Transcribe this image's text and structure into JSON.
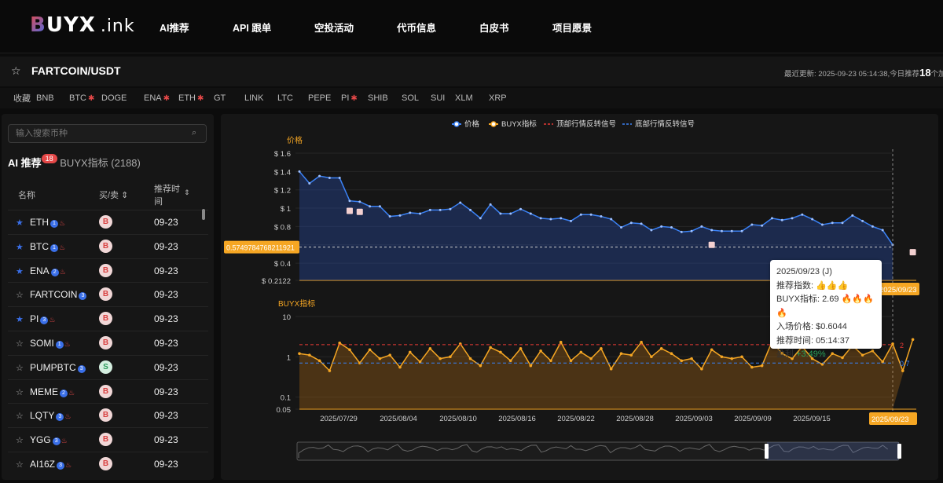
{
  "logo": {
    "text_b": "B",
    "text_rest": "UYX",
    "ink": ".ink"
  },
  "nav": [
    "AI推荐",
    "API 跟单",
    "空投活动",
    "代币信息",
    "白皮书",
    "项目愿景"
  ],
  "pair": {
    "name": "FARTCOIN/USDT",
    "updated": "最近更新: 2025-09-23 05:14:38,今日推荐",
    "count": "18",
    "trail": "个加"
  },
  "fav": {
    "label": "收藏",
    "items": [
      {
        "t": "BNB",
        "d": false
      },
      {
        "t": "BTC",
        "d": true
      },
      {
        "t": "DOGE",
        "d": false
      },
      {
        "t": "ENA",
        "d": true
      },
      {
        "t": "ETH",
        "d": true
      },
      {
        "t": "GT",
        "d": false
      },
      {
        "t": "LINK",
        "d": false
      },
      {
        "t": "LTC",
        "d": false
      },
      {
        "t": "PEPE",
        "d": false
      },
      {
        "t": "PI",
        "d": true
      },
      {
        "t": "SHIB",
        "d": false
      },
      {
        "t": "SOL",
        "d": false
      },
      {
        "t": "SUI",
        "d": false
      },
      {
        "t": "XLM",
        "d": false
      },
      {
        "t": "XRP",
        "d": false
      }
    ]
  },
  "search": {
    "placeholder": "输入搜索币种"
  },
  "tabs": {
    "ai": "AI 推荐",
    "ai_count": "18",
    "buyx": "BUYX指标 (2188)"
  },
  "table": {
    "h_name": "名称",
    "h_side": "买/卖 ⇕",
    "h_time1": "推荐时",
    "h_time2": "间",
    "rows": [
      {
        "name": "ETH",
        "star": true,
        "n": "1",
        "fire": true,
        "side": "B",
        "date": "09-23"
      },
      {
        "name": "BTC",
        "star": true,
        "n": "1",
        "fire": true,
        "side": "B",
        "date": "09-23"
      },
      {
        "name": "ENA",
        "star": true,
        "n": "2",
        "fire": true,
        "side": "B",
        "date": "09-23"
      },
      {
        "name": "FARTCOIN",
        "star": false,
        "n": "3",
        "fire": false,
        "side": "B",
        "date": "09-23"
      },
      {
        "name": "PI",
        "star": true,
        "n": "3",
        "fire": true,
        "side": "B",
        "date": "09-23"
      },
      {
        "name": "SOMI",
        "star": false,
        "n": "1",
        "fire": true,
        "side": "B",
        "date": "09-23"
      },
      {
        "name": "PUMPBTC",
        "star": false,
        "n": "3",
        "fire": false,
        "side": "S",
        "date": "09-23"
      },
      {
        "name": "MEME",
        "star": false,
        "n": "2",
        "fire": true,
        "side": "B",
        "date": "09-23"
      },
      {
        "name": "LQTY",
        "star": false,
        "n": "3",
        "fire": true,
        "side": "B",
        "date": "09-23"
      },
      {
        "name": "YGG",
        "star": false,
        "n": "3",
        "fire": true,
        "side": "B",
        "date": "09-23"
      },
      {
        "name": "AI16Z",
        "star": false,
        "n": "3",
        "fire": true,
        "side": "B",
        "date": "09-23"
      }
    ]
  },
  "legend": [
    "价格",
    "BUYX指标",
    "顶部行情反转信号",
    "底部行情反转信号"
  ],
  "colors": {
    "price": "#3b82f6",
    "buyx": "#f5a623",
    "top": "#e53935",
    "bottom": "#3b82f6"
  },
  "chart_data": [
    {
      "type": "line",
      "title": "价格",
      "ylabel": "价格",
      "y_ticks": [
        "$ 1.6",
        "$ 1.4",
        "$ 1.2",
        "$ 1",
        "$ 0.8",
        "$ 0.6",
        "$ 0.4",
        "$ 0.2122"
      ],
      "ylim": [
        0.2122,
        1.6
      ],
      "current_label": "0.5749784768211921",
      "x": [
        "2025/07/24",
        "2025/07/25",
        "2025/07/26",
        "2025/07/27",
        "2025/07/28",
        "2025/07/29",
        "2025/07/30",
        "2025/07/31",
        "2025/08/01",
        "2025/08/02",
        "2025/08/03",
        "2025/08/04",
        "2025/08/05",
        "2025/08/06",
        "2025/08/07",
        "2025/08/08",
        "2025/08/09",
        "2025/08/10",
        "2025/08/11",
        "2025/08/12",
        "2025/08/13",
        "2025/08/14",
        "2025/08/15",
        "2025/08/16",
        "2025/08/17",
        "2025/08/18",
        "2025/08/19",
        "2025/08/20",
        "2025/08/21",
        "2025/08/22",
        "2025/08/23",
        "2025/08/24",
        "2025/08/25",
        "2025/08/26",
        "2025/08/27",
        "2025/08/28",
        "2025/08/29",
        "2025/08/30",
        "2025/08/31",
        "2025/09/01",
        "2025/09/02",
        "2025/09/03",
        "2025/09/04",
        "2025/09/05",
        "2025/09/06",
        "2025/09/07",
        "2025/09/08",
        "2025/09/09",
        "2025/09/10",
        "2025/09/11",
        "2025/09/12",
        "2025/09/13",
        "2025/09/14",
        "2025/09/15",
        "2025/09/16",
        "2025/09/17",
        "2025/09/18",
        "2025/09/19",
        "2025/09/20",
        "2025/09/21",
        "2025/09/22",
        "2025/09/23"
      ],
      "series": [
        {
          "name": "价格",
          "values": [
            1.4,
            1.27,
            1.35,
            1.33,
            1.33,
            1.08,
            1.07,
            1.02,
            1.02,
            0.91,
            0.92,
            0.95,
            0.94,
            0.98,
            0.98,
            0.99,
            1.06,
            0.98,
            0.89,
            1.04,
            0.94,
            0.94,
            0.99,
            0.94,
            0.89,
            0.88,
            0.89,
            0.86,
            0.93,
            0.93,
            0.91,
            0.88,
            0.79,
            0.84,
            0.83,
            0.76,
            0.8,
            0.79,
            0.74,
            0.75,
            0.8,
            0.76,
            0.75,
            0.75,
            0.75,
            0.82,
            0.81,
            0.89,
            0.87,
            0.89,
            0.93,
            0.88,
            0.82,
            0.84,
            0.84,
            0.92,
            0.86,
            0.8,
            0.76,
            0.6
          ]
        }
      ]
    },
    {
      "type": "line",
      "title": "BUYX指标",
      "ylabel": "BUYX指标",
      "scale": "log",
      "y_ticks": [
        "10",
        "1",
        "0.1",
        "0.05"
      ],
      "ylim": [
        0.05,
        10
      ],
      "ref_lines": [
        {
          "name": "顶部行情反转信号",
          "value": 2
        },
        {
          "name": "底部行情反转信号",
          "value": 0.7
        }
      ],
      "x_ticks": [
        "2025/07/29",
        "2025/08/04",
        "2025/08/10",
        "2025/08/16",
        "2025/08/22",
        "2025/08/28",
        "2025/09/03",
        "2025/09/09",
        "2025/09/15",
        "2025/09/23"
      ],
      "series": [
        {
          "name": "BUYX指标",
          "values": [
            1.2,
            1.1,
            0.8,
            0.45,
            2.2,
            1.5,
            0.7,
            1.5,
            0.9,
            1.1,
            0.55,
            1.3,
            0.75,
            1.6,
            0.9,
            1.0,
            2.1,
            0.9,
            0.6,
            1.7,
            1.3,
            0.8,
            1.6,
            0.6,
            1.4,
            0.8,
            2.3,
            0.8,
            1.3,
            0.9,
            1.6,
            0.5,
            1.2,
            1.1,
            2.3,
            1.0,
            1.6,
            1.2,
            0.8,
            0.9,
            0.5,
            1.5,
            1.0,
            0.9,
            1.0,
            0.55,
            0.6,
            2.4,
            1.2,
            0.9,
            1.8,
            0.9,
            0.65,
            1.2,
            0.95,
            1.9,
            1.1,
            1.4,
            0.75,
            2.1,
            0.45,
            2.69
          ]
        }
      ]
    }
  ],
  "tooltip": {
    "date": "2025/09/23 (J)",
    "score": "推荐指数:",
    "buyx": "BUYX指标: 2.69",
    "entry": "入场价格: $0.6044",
    "time": "推荐时间: 05:14:37",
    "profit_label": "盈利",
    "profit": "+3.49%"
  },
  "labels": {
    "date_now": "2025/09/23",
    "ref_top": "2",
    "ref_bottom": "0.7"
  }
}
